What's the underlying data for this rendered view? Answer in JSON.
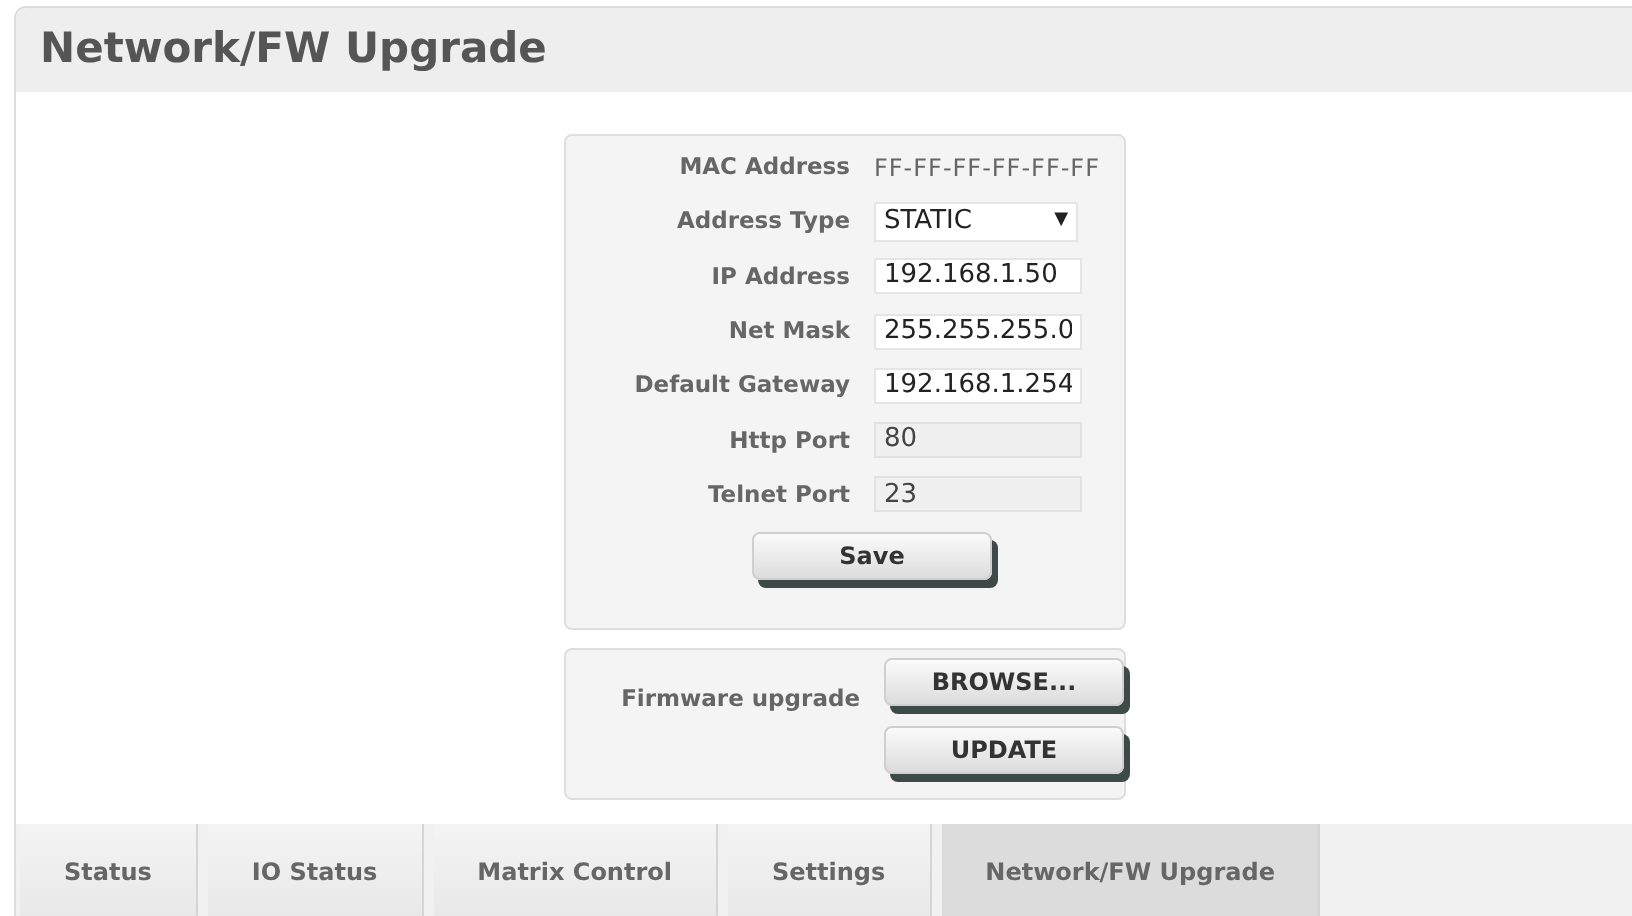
{
  "page_title": "Network/FW Upgrade",
  "network_fields": [
    {
      "label": "MAC Address",
      "kind": "text",
      "value": "FF-FF-FF-FF-FF-FF"
    },
    {
      "label": "Address Type",
      "kind": "select",
      "value": "STATIC",
      "caret": "▼"
    },
    {
      "label": "IP Address",
      "kind": "input",
      "value": "192.168.1.50"
    },
    {
      "label": "Net Mask",
      "kind": "input",
      "value": "255.255.255.0"
    },
    {
      "label": "Default Gateway",
      "kind": "input",
      "value": "192.168.1.254"
    },
    {
      "label": "Http Port",
      "kind": "readonly",
      "value": "80"
    },
    {
      "label": "Telnet Port",
      "kind": "readonly",
      "value": "23"
    }
  ],
  "save_button": "Save",
  "firmware": {
    "label": "Firmware upgrade",
    "browse_button": "BROWSE...",
    "update_button": "UPDATE"
  },
  "tabs": [
    {
      "label": "Status",
      "selected": false
    },
    {
      "label": "IO Status",
      "selected": false
    },
    {
      "label": "Matrix Control",
      "selected": false
    },
    {
      "label": "Settings",
      "selected": false
    },
    {
      "label": "Network/FW Upgrade",
      "selected": true
    }
  ]
}
